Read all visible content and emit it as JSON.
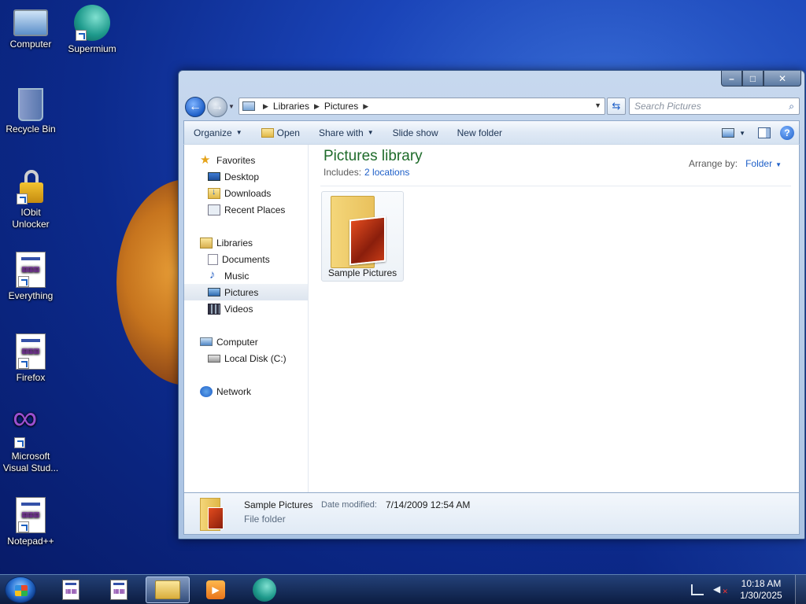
{
  "desktop": {
    "icons": [
      {
        "label": "Computer",
        "icon": "computer-icon"
      },
      {
        "label": "Supermium",
        "icon": "supermium-icon"
      },
      {
        "label": "Recycle Bin",
        "icon": "recycle-bin-icon"
      },
      {
        "label": "IObit Unlocker",
        "icon": "unlock-icon"
      },
      {
        "label": "Everything",
        "icon": "application-icon"
      },
      {
        "label": "Firefox",
        "icon": "application-icon"
      },
      {
        "label": "Microsoft Visual Stud...",
        "icon": "visual-studio-icon"
      },
      {
        "label": "Notepad++",
        "icon": "application-icon"
      }
    ]
  },
  "window": {
    "caption": {
      "minimize": "–",
      "maximize": "□",
      "close": "✕"
    },
    "address": {
      "crumbs": [
        "Libraries",
        "Pictures"
      ]
    },
    "search": {
      "placeholder": "Search Pictures"
    },
    "toolbar": {
      "organize": "Organize",
      "open": "Open",
      "share_with": "Share with",
      "slide_show": "Slide show",
      "new_folder": "New folder",
      "help": "?"
    },
    "nav": {
      "favorites": "Favorites",
      "favorites_items": [
        "Desktop",
        "Downloads",
        "Recent Places"
      ],
      "libraries": "Libraries",
      "libraries_items": [
        "Documents",
        "Music",
        "Pictures",
        "Videos"
      ],
      "computer": "Computer",
      "computer_items": [
        "Local Disk (C:)"
      ],
      "network": "Network",
      "selected": "Pictures"
    },
    "main": {
      "title": "Pictures library",
      "includes_label": "Includes:",
      "includes_link": "2 locations",
      "arrange_label": "Arrange by:",
      "arrange_value": "Folder",
      "items": [
        {
          "name": "Sample Pictures"
        }
      ]
    },
    "details": {
      "name": "Sample Pictures",
      "modified_label": "Date modified:",
      "modified_value": "7/14/2009 12:54 AM",
      "type": "File folder"
    }
  },
  "taskbar": {
    "clock_time": "10:18 AM",
    "clock_date": "1/30/2025"
  },
  "colors": {
    "library_title": "#1e6b2a",
    "link": "#1e5fc8",
    "desktop_bg": "#0c2a8c"
  }
}
